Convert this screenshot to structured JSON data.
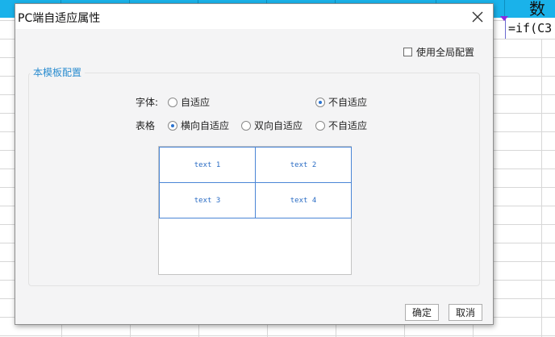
{
  "background": {
    "header_fragment": "数",
    "formula_fragment": "=if(C3"
  },
  "dialog": {
    "title": "PC端自适应属性",
    "close_glyph": "✕",
    "use_global_config_label": "使用全局配置",
    "section_title": "本模板配置",
    "font_row": {
      "label": "字体:",
      "options": [
        {
          "label": "自适应",
          "selected": false
        },
        {
          "label": "不自适应",
          "selected": true
        }
      ]
    },
    "table_row": {
      "label": "表格",
      "options": [
        {
          "label": "横向自适应",
          "selected": true
        },
        {
          "label": "双向自适应",
          "selected": false
        },
        {
          "label": "不自适应",
          "selected": false
        }
      ]
    },
    "preview": {
      "cells": [
        "text 1",
        "text 2",
        "text 3",
        "text 4"
      ]
    },
    "ok_label": "确定",
    "cancel_label": "取消"
  },
  "colors": {
    "sheet_header": "#1ab2ea",
    "section_title": "#2a8ccf",
    "preview_border": "#4a86d6",
    "radio_dot": "#2a73d0"
  }
}
